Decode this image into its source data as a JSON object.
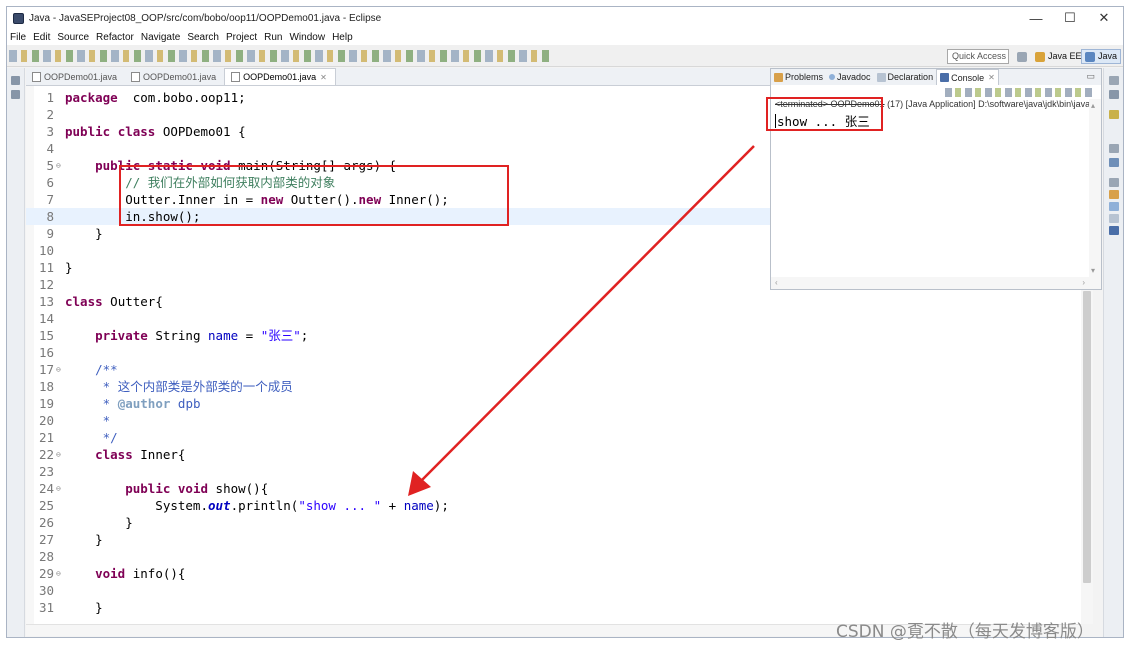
{
  "window": {
    "title": "Java - JavaSEProject08_OOP/src/com/bobo/oop11/OOPDemo01.java - Eclipse",
    "controls": {
      "minimize": "—",
      "maximize": "☐",
      "close": "✕"
    }
  },
  "menu": [
    "File",
    "Edit",
    "Source",
    "Refactor",
    "Navigate",
    "Search",
    "Project",
    "Run",
    "Window",
    "Help"
  ],
  "toolbar": {
    "quick_access": "Quick Access",
    "perspectives": [
      "Java EE",
      "Java"
    ]
  },
  "editor": {
    "tabs": [
      {
        "label": "OOPDemo01.java",
        "active": false
      },
      {
        "label": "OOPDemo01.java",
        "active": false
      },
      {
        "label": "OOPDemo01.java",
        "active": true,
        "close": "✕"
      }
    ],
    "current_line": 8,
    "lines": [
      {
        "n": "1",
        "tokens": [
          [
            "kw",
            "package"
          ],
          [
            "",
            "  com.bobo.oop11;"
          ]
        ]
      },
      {
        "n": "2",
        "tokens": []
      },
      {
        "n": "3",
        "tokens": [
          [
            "kw",
            "public"
          ],
          [
            "",
            " "
          ],
          [
            "kw",
            "class"
          ],
          [
            "",
            " OOPDemo01 {"
          ]
        ]
      },
      {
        "n": "4",
        "tokens": []
      },
      {
        "n": "5",
        "fold": "⊖",
        "tokens": [
          [
            "",
            "    "
          ],
          [
            "kw",
            "public"
          ],
          [
            "",
            " "
          ],
          [
            "kw",
            "static"
          ],
          [
            "",
            " "
          ],
          [
            "kw",
            "void"
          ],
          [
            "",
            " main(String[] args) {"
          ]
        ]
      },
      {
        "n": "6",
        "tokens": [
          [
            "",
            "        "
          ],
          [
            "cm",
            "// 我们在外部如何获取内部类的对象"
          ]
        ]
      },
      {
        "n": "7",
        "tokens": [
          [
            "",
            "        Outter.Inner in = "
          ],
          [
            "kw",
            "new"
          ],
          [
            "",
            " Outter()."
          ],
          [
            "kw",
            "new"
          ],
          [
            "",
            " Inner();"
          ]
        ]
      },
      {
        "n": "8",
        "tokens": [
          [
            "",
            "        in.show();"
          ]
        ]
      },
      {
        "n": "9",
        "tokens": [
          [
            "",
            "    }"
          ]
        ]
      },
      {
        "n": "10",
        "tokens": []
      },
      {
        "n": "11",
        "tokens": [
          [
            "",
            "}"
          ]
        ]
      },
      {
        "n": "12",
        "tokens": []
      },
      {
        "n": "13",
        "tokens": [
          [
            "kw",
            "class"
          ],
          [
            "",
            " Outter{"
          ]
        ]
      },
      {
        "n": "14",
        "tokens": []
      },
      {
        "n": "15",
        "tokens": [
          [
            "",
            "    "
          ],
          [
            "kw",
            "private"
          ],
          [
            "",
            " String "
          ],
          [
            "fld",
            "name"
          ],
          [
            "",
            " = "
          ],
          [
            "str",
            "\"张三\""
          ],
          [
            "",
            ";"
          ]
        ]
      },
      {
        "n": "16",
        "tokens": []
      },
      {
        "n": "17",
        "fold": "⊖",
        "tokens": [
          [
            "",
            "    "
          ],
          [
            "jd",
            "/**"
          ]
        ]
      },
      {
        "n": "18",
        "tokens": [
          [
            "",
            "     "
          ],
          [
            "jd",
            "* 这个内部类是外部类的一个成员"
          ]
        ]
      },
      {
        "n": "19",
        "tokens": [
          [
            "",
            "     "
          ],
          [
            "jd",
            "* "
          ],
          [
            "tag",
            "@author"
          ],
          [
            "jd",
            " dpb"
          ]
        ]
      },
      {
        "n": "20",
        "tokens": [
          [
            "",
            "     "
          ],
          [
            "jd",
            "*"
          ]
        ]
      },
      {
        "n": "21",
        "tokens": [
          [
            "",
            "     "
          ],
          [
            "jd",
            "*/"
          ]
        ]
      },
      {
        "n": "22",
        "fold": "⊖",
        "tokens": [
          [
            "",
            "    "
          ],
          [
            "kw",
            "class"
          ],
          [
            "",
            " Inner{"
          ]
        ]
      },
      {
        "n": "23",
        "tokens": []
      },
      {
        "n": "24",
        "fold": "⊖",
        "tokens": [
          [
            "",
            "        "
          ],
          [
            "kw",
            "public"
          ],
          [
            "",
            " "
          ],
          [
            "kw",
            "void"
          ],
          [
            "",
            " show(){"
          ]
        ]
      },
      {
        "n": "25",
        "tokens": [
          [
            "",
            "            System."
          ],
          [
            "stf",
            "out"
          ],
          [
            "",
            ".println("
          ],
          [
            "str",
            "\"show ... \""
          ],
          [
            "",
            " + "
          ],
          [
            "fld",
            "name"
          ],
          [
            "",
            ");"
          ]
        ]
      },
      {
        "n": "26",
        "tokens": [
          [
            "",
            "        }"
          ]
        ]
      },
      {
        "n": "27",
        "tokens": [
          [
            "",
            "    }"
          ]
        ]
      },
      {
        "n": "28",
        "tokens": []
      },
      {
        "n": "29",
        "fold": "⊖",
        "tokens": [
          [
            "",
            "    "
          ],
          [
            "kw",
            "void"
          ],
          [
            "",
            " info(){"
          ]
        ]
      },
      {
        "n": "30",
        "tokens": []
      },
      {
        "n": "31",
        "tokens": [
          [
            "",
            "    }"
          ]
        ]
      }
    ]
  },
  "console": {
    "tabs": [
      "Problems",
      "Javadoc",
      "Declaration",
      "Console"
    ],
    "active_tab": "Console",
    "status_prefix": "<terminated> OOPDemo01",
    "status_rest": " (17) [Java Application] D:\\software\\java\\jdk\\bin\\javaw",
    "output": "show ... 张三"
  },
  "watermark": "CSDN @覔不散（每天发博客版）",
  "colors": {
    "annotation_red": "#e02222",
    "keyword": "#7f0055",
    "string": "#2a00ff",
    "comment": "#3f7f5f",
    "javadoc": "#3f5fbf",
    "current_line": "#e8f2fe"
  }
}
